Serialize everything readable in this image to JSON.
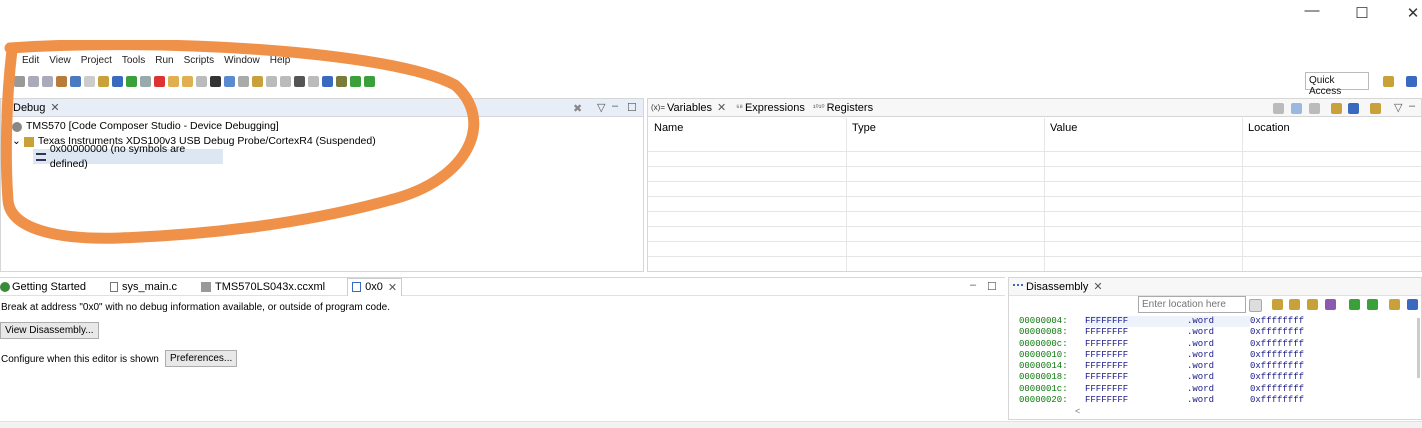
{
  "window": {
    "minimize_glyph": "✕",
    "maximize_glyph": "☐",
    "close_glyph": "✕"
  },
  "menu": [
    "Edit",
    "View",
    "Project",
    "Tools",
    "Run",
    "Scripts",
    "Window",
    "Help"
  ],
  "toolbar": {
    "quick_access": "Quick Access"
  },
  "debug": {
    "tab": "Debug",
    "items": [
      "TMS570 [Code Composer Studio - Device Debugging]",
      "Texas Instruments XDS100v3 USB Debug Probe/CortexR4 (Suspended)",
      "0x00000000  (no symbols are defined)"
    ]
  },
  "variables": {
    "tabs": [
      "Variables",
      "Expressions",
      "Registers"
    ],
    "tab_prefixes": [
      "(x)=",
      "⁶⁸",
      "¹⁰¹⁰"
    ],
    "columns": [
      "Name",
      "Type",
      "Value",
      "Location"
    ]
  },
  "editor": {
    "tabs": [
      "Getting Started",
      "sys_main.c",
      "TMS570LS043x.ccxml",
      "0x0"
    ],
    "message": "Break at address \"0x0\" with no debug information available, or outside of program code.",
    "view_disassembly": "View Disassembly...",
    "configure_label": "Configure when this editor is shown",
    "preferences": "Preferences..."
  },
  "disassembly": {
    "tab": "Disassembly",
    "location_placeholder": "Enter location here",
    "rows": [
      {
        "addr": "00000004:",
        "code": "FFFFFFFF",
        "op": ".word",
        "arg": "0xffffffff"
      },
      {
        "addr": "00000008:",
        "code": "FFFFFFFF",
        "op": ".word",
        "arg": "0xffffffff"
      },
      {
        "addr": "0000000c:",
        "code": "FFFFFFFF",
        "op": ".word",
        "arg": "0xffffffff"
      },
      {
        "addr": "00000010:",
        "code": "FFFFFFFF",
        "op": ".word",
        "arg": "0xffffffff"
      },
      {
        "addr": "00000014:",
        "code": "FFFFFFFF",
        "op": ".word",
        "arg": "0xffffffff"
      },
      {
        "addr": "00000018:",
        "code": "FFFFFFFF",
        "op": ".word",
        "arg": "0xffffffff"
      },
      {
        "addr": "0000001c:",
        "code": "FFFFFFFF",
        "op": ".word",
        "arg": "0xffffffff"
      },
      {
        "addr": "00000020:",
        "code": "FFFFFFFF",
        "op": ".word",
        "arg": "0xffffffff"
      }
    ],
    "scroll_left_glyph": "<"
  },
  "colors": {
    "annotation": "#f0914a",
    "selection": "#dde6f3",
    "addr": "#0a7a0a",
    "code": "#1a1a8a"
  }
}
